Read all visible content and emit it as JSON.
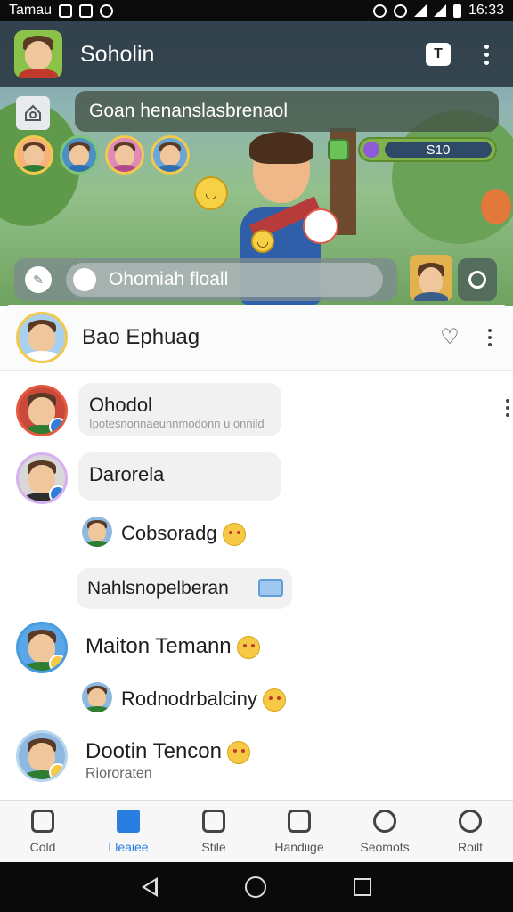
{
  "status_bar": {
    "carrier": "Tamau",
    "time": "16:33"
  },
  "app_bar": {
    "title": "Soholin",
    "new_button_label": "T"
  },
  "hero": {
    "banner_text": "Goan henanslasbrenaol",
    "score_value": "S10",
    "search_placeholder": "Ohomiah floall"
  },
  "chat_header": {
    "title": "Bao Ephuag"
  },
  "messages": [
    {
      "kind": "bubble",
      "title": "Ohodol",
      "subtitle": "Ipotesnonnaeunnmodonn u onnild"
    },
    {
      "kind": "bubble",
      "title": "Darorela"
    },
    {
      "kind": "inline",
      "text": "Cobsoradg"
    },
    {
      "kind": "bubble-emoji",
      "title": "Nahlsnopelberan"
    },
    {
      "kind": "name",
      "text": "Maiton Temann"
    },
    {
      "kind": "inline",
      "text": "Rodnodrbalciny"
    },
    {
      "kind": "name",
      "text": "Dootin Tencon",
      "subtitle": "Riororaten"
    }
  ],
  "bottom_nav": [
    {
      "label": "Cold",
      "icon": "camera-icon",
      "active": false
    },
    {
      "label": "Lleaiee",
      "icon": "chart-icon",
      "active": true
    },
    {
      "label": "Stile",
      "icon": "list-icon",
      "active": false
    },
    {
      "label": "Handiige",
      "icon": "trash-icon",
      "active": false
    },
    {
      "label": "Seomots",
      "icon": "person-icon",
      "active": false
    },
    {
      "label": "Roilt",
      "icon": "target-icon",
      "active": false
    }
  ],
  "colors": {
    "accent": "#2a7de1",
    "app_bar": "#2e3c46"
  }
}
